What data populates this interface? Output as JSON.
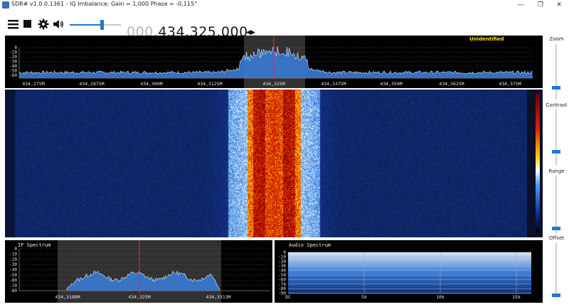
{
  "window": {
    "title": "SDR# v1.0.0.1361 - IQ Imbalance: Gain = 1,000 Phase = -0,115°",
    "minimize_glyph": "—",
    "maximize_glyph": "❐",
    "close_glyph": "✕"
  },
  "toolbar": {
    "menu_icon": "menu-icon",
    "stop_icon": "stop-icon",
    "settings_icon": "gear-icon",
    "audio_icon": "speaker-icon",
    "volume_level": 0.62,
    "frequency_dim": "000.",
    "frequency_main": "434.325.000",
    "tune_glyph": "◂▸"
  },
  "spectrum": {
    "db_labels": [
      "0",
      "-10",
      "-20",
      "-30",
      "-40",
      "-50",
      "-60"
    ],
    "freq_labels": [
      "434,275M",
      "434,2875M",
      "434,300M",
      "434,3125M",
      "434,325M",
      "434,3375M",
      "434,350M",
      "434,3625M",
      "434,375M"
    ],
    "station_label": "Unidentified"
  },
  "if_spectrum": {
    "title": "IF Spectrum",
    "db_labels": [
      "0",
      "-10",
      "-20",
      "-30",
      "-40",
      "-50",
      "-60",
      "-70",
      "-80"
    ],
    "freq_labels": [
      "434,3188M",
      "434,325M",
      "434,3313M"
    ]
  },
  "audio_spectrum": {
    "title": "Audio Spectrum",
    "db_labels": [
      "0",
      "-10",
      "-20",
      "-30",
      "-40",
      "-50",
      "-60",
      "-70",
      "-80",
      "-90"
    ],
    "freq_labels": [
      "DC",
      "5k",
      "10k",
      "15k"
    ]
  },
  "sliders": {
    "zoom": {
      "label": "Zoom",
      "value": 0.22
    },
    "contrast": {
      "label": "Contrast",
      "value": 0.25
    },
    "range": {
      "label": "Range",
      "value": 0.1
    },
    "offset": {
      "label": "Offset",
      "value": 0.06
    }
  },
  "colors": {
    "accent": "#1f78d6",
    "center_marker": "#ff2020",
    "spectrum_fill": "#3a7bd5",
    "station_label": "#ffe000"
  }
}
